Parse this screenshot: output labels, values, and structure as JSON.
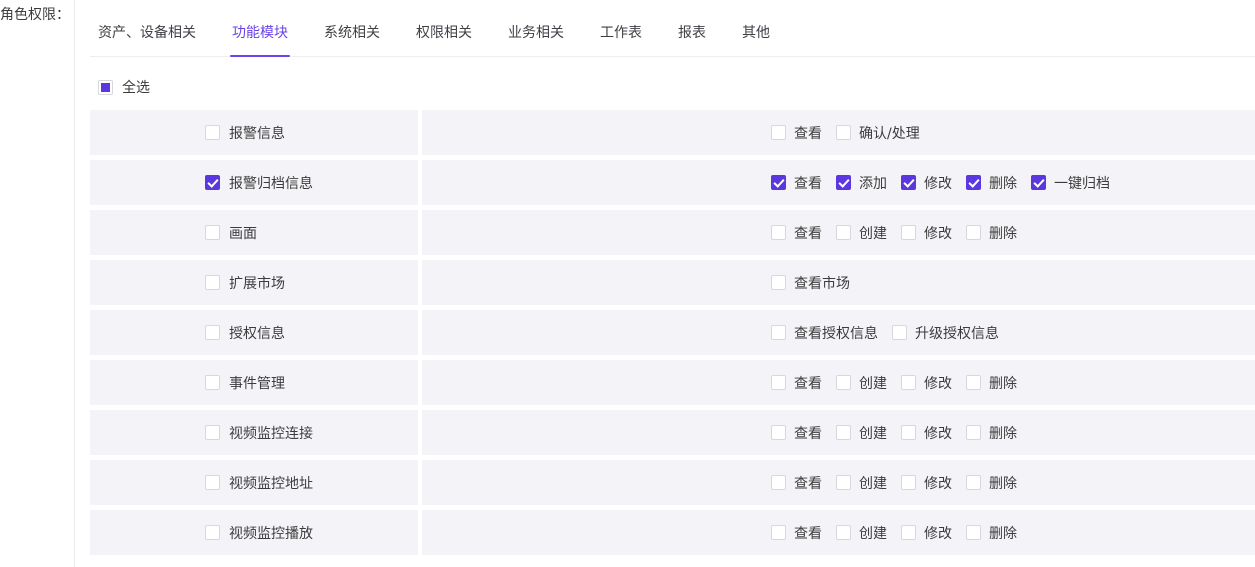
{
  "form": {
    "field_label": "角色权限："
  },
  "theme": {
    "accent": "#5b37e0",
    "tab_active": "#6a44e8",
    "row_bg": "#f4f4f8"
  },
  "tabs": [
    {
      "label": "资产、设备相关",
      "active": false
    },
    {
      "label": "功能模块",
      "active": true
    },
    {
      "label": "系统相关",
      "active": false
    },
    {
      "label": "权限相关",
      "active": false
    },
    {
      "label": "业务相关",
      "active": false
    },
    {
      "label": "工作表",
      "active": false
    },
    {
      "label": "报表",
      "active": false
    },
    {
      "label": "其他",
      "active": false
    }
  ],
  "select_all": {
    "label": "全选",
    "state": "indeterminate"
  },
  "rows": [
    {
      "name": "报警信息",
      "checked": false,
      "actions": [
        {
          "label": "查看",
          "checked": false
        },
        {
          "label": "确认/处理",
          "checked": false
        }
      ]
    },
    {
      "name": "报警归档信息",
      "checked": true,
      "actions": [
        {
          "label": "查看",
          "checked": true
        },
        {
          "label": "添加",
          "checked": true
        },
        {
          "label": "修改",
          "checked": true
        },
        {
          "label": "删除",
          "checked": true
        },
        {
          "label": "一键归档",
          "checked": true
        }
      ]
    },
    {
      "name": "画面",
      "checked": false,
      "actions": [
        {
          "label": "查看",
          "checked": false
        },
        {
          "label": "创建",
          "checked": false
        },
        {
          "label": "修改",
          "checked": false
        },
        {
          "label": "删除",
          "checked": false
        }
      ]
    },
    {
      "name": "扩展市场",
      "checked": false,
      "actions": [
        {
          "label": "查看市场",
          "checked": false
        }
      ]
    },
    {
      "name": "授权信息",
      "checked": false,
      "actions": [
        {
          "label": "查看授权信息",
          "checked": false
        },
        {
          "label": "升级授权信息",
          "checked": false
        }
      ]
    },
    {
      "name": "事件管理",
      "checked": false,
      "actions": [
        {
          "label": "查看",
          "checked": false
        },
        {
          "label": "创建",
          "checked": false
        },
        {
          "label": "修改",
          "checked": false
        },
        {
          "label": "删除",
          "checked": false
        }
      ]
    },
    {
      "name": "视频监控连接",
      "checked": false,
      "actions": [
        {
          "label": "查看",
          "checked": false
        },
        {
          "label": "创建",
          "checked": false
        },
        {
          "label": "修改",
          "checked": false
        },
        {
          "label": "删除",
          "checked": false
        }
      ]
    },
    {
      "name": "视频监控地址",
      "checked": false,
      "actions": [
        {
          "label": "查看",
          "checked": false
        },
        {
          "label": "创建",
          "checked": false
        },
        {
          "label": "修改",
          "checked": false
        },
        {
          "label": "删除",
          "checked": false
        }
      ]
    },
    {
      "name": "视频监控播放",
      "checked": false,
      "actions": [
        {
          "label": "查看",
          "checked": false
        },
        {
          "label": "创建",
          "checked": false
        },
        {
          "label": "修改",
          "checked": false
        },
        {
          "label": "删除",
          "checked": false
        }
      ]
    }
  ]
}
